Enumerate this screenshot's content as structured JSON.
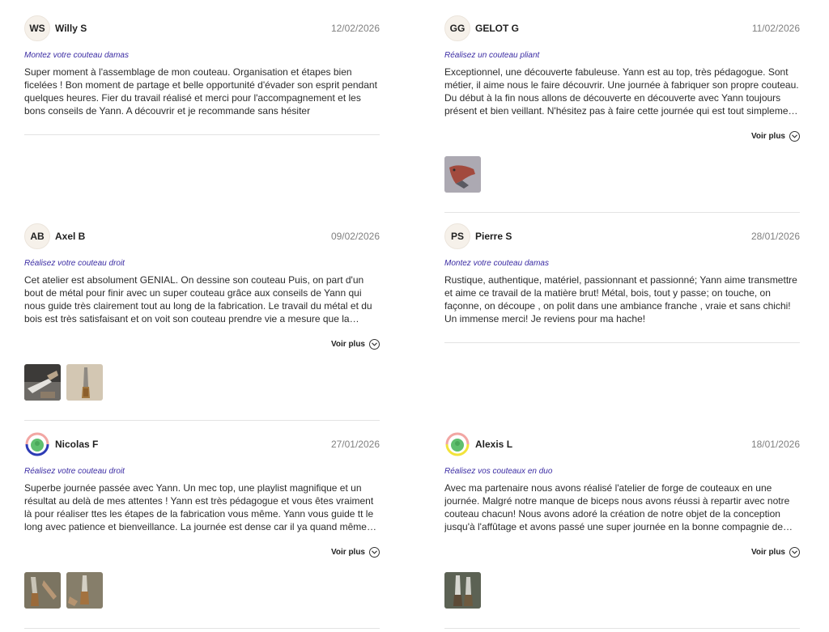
{
  "reviews": [
    {
      "initials": "WS",
      "name": "Willy S",
      "date": "12/02/2026",
      "product": "Montez votre couteau damas",
      "text": "Super moment à l'assemblage de mon couteau. Organisation et étapes bien ficelées ! Bon moment de partage et belle opportunité d'évader son esprit pendant quelques heures. Fier du travail réalisé et merci pour l'accompagnement et les bons conseils de Yann. A découvrir et je recommande sans hésiter"
    },
    {
      "initials": "GG",
      "name": "GELOT G",
      "date": "11/02/2026",
      "product": "Réalisez un couteau pliant",
      "text": "Exceptionnel, une découverte fabuleuse. Yann est au top, très pédagogue. Sont métier, il aime nous le faire découvrir. Une journée à fabriquer son propre couteau. Du début à la fin nous allons de découverte en découverte avec Yann toujours présent et bien veillant. N'hésitez pas à faire cette journée qui est tout simplement exceptionnelle.",
      "more_label": "Voir plus"
    },
    {
      "initials": "AB",
      "name": "Axel B",
      "date": "09/02/2026",
      "product": "Réalisez votre couteau droit",
      "text": "Cet atelier est absolument GENIAL. On dessine son couteau Puis, on part d'un bout de métal pour finir avec un super couteau grâce aux conseils de Yann qui nous guide très clairement tout au long de la fabrication. Le travail du métal et du bois est très satisfaisant et on voit son couteau prendre vie a mesure que la journée avance.",
      "more_label": "Voir plus"
    },
    {
      "initials": "PS",
      "name": "Pierre S",
      "date": "28/01/2026",
      "product": "Montez votre couteau damas",
      "text": "Rustique, authentique, matériel, passionnant et passionné; Yann aime transmettre et aime ce travail de la matière brut! Métal, bois, tout y passe; on touche, on façonne, on découpe , on polit dans une ambiance franche , vraie et sans chichi! Un immense merci! Je reviens pour ma hache!"
    },
    {
      "name": "Nicolas F",
      "date": "27/01/2026",
      "product": "Réalisez votre couteau droit",
      "text": "Superbe journée passée avec Yann. Un mec top, une playlist magnifique et un résultat au delà de mes attentes ! Yann est très pédagogue et vous êtes vraiment là pour réaliser ttes les étapes de la fabrication vous même. Yann vous guide tt le long avec patience et bienveillance. La journée est dense car il ya quand même bcp de choses à faire.",
      "more_label": "Voir plus"
    },
    {
      "name": "Alexis L",
      "date": "18/01/2026",
      "product": "Réalisez vos couteaux en duo",
      "text": "Avec ma partenaire nous avons réalisé l'atelier de forge de couteaux en une journée. Malgré notre manque de biceps nous avons réussi à repartir avec notre couteau chacun! Nous avons adoré la création de notre objet de la conception jusqu'à l'affûtage et avons passé une super journée en la bonne compagnie de Yann.",
      "more_label": "Voir plus"
    }
  ],
  "colors": {
    "product_link": "#3a2ba3",
    "date": "#808080",
    "divider": "#e3e3e3",
    "avatar_bg": "#f6f1ea"
  }
}
